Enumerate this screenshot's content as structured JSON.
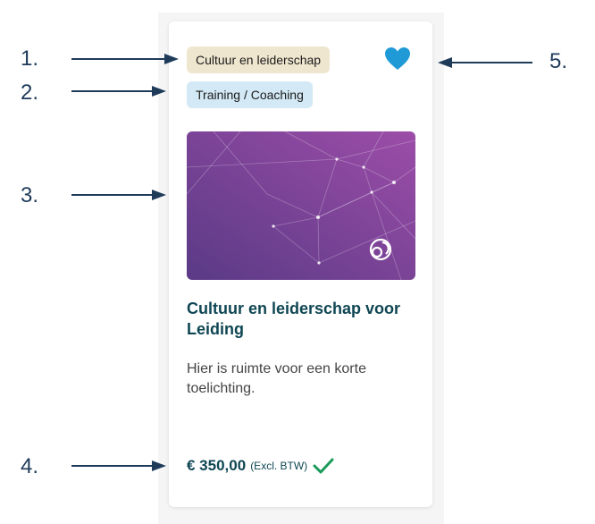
{
  "annotations": {
    "n1": "1.",
    "n2": "2.",
    "n3": "3.",
    "n4": "4.",
    "n5": "5."
  },
  "card": {
    "category_tag": "Cultuur en leiderschap",
    "type_tag": "Training / Coaching",
    "title": "Cultuur en leiderschap voor Leiding",
    "description": "Hier is ruimte voor een korte toelichting.",
    "price": "€ 350,00",
    "vat_note": "(Excl. BTW)",
    "favorite_icon": "heart-icon",
    "check_icon": "checkmark-icon"
  },
  "colors": {
    "title": "#0f4653",
    "category_tag_bg": "#efe6cf",
    "type_tag_bg": "#d3e9f5",
    "heart": "#1f9ad6",
    "check": "#1a9a5a",
    "image_gradient_start": "#5a3a86",
    "image_gradient_end": "#9c4da8",
    "annotation": "#1f3b5a"
  }
}
